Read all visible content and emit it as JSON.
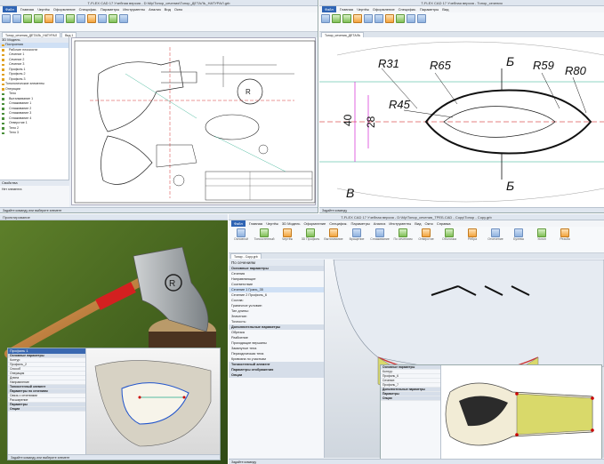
{
  "q1": {
    "title": "T-FLEX CAD 17 Учебная версия - D:\\My\\Топор_сечения\\Топор_ДЕТАЛЬ_НАТУРАЛ.grb",
    "menu": [
      "Файл",
      "Главная",
      "Чертёж",
      "Оформление",
      "Специфик.",
      "Параметры",
      "Инструменты",
      "Анализ",
      "Вид",
      "Окно"
    ],
    "tabs": [
      "Топор_сечения_ДЕТАЛЬ_НАТУРАЛ",
      "Вид 1"
    ],
    "tree_title": "3D Модель",
    "tree_rows": [
      "Построения",
      "Рабочие плоскости",
      "Сечение 1",
      "Сечение 2",
      "Сечение 3",
      "Профиль 1",
      "Профиль 2",
      "Профиль 3",
      "Топологические элементы",
      "Операции",
      "Тело",
      "Выталкивание 1",
      "Сглаживание 1",
      "Сглаживание 2",
      "Сглаживание 3",
      "Сглаживание 4",
      "Отверстие 1",
      "Тело 2",
      "Тело 3"
    ],
    "props_title": "Свойства",
    "props_label": "Нет элемента",
    "status": "Задайте команду или выберите элемент"
  },
  "q2": {
    "title": "T-FLEX CAD 17 Учебная версия - Топор_сечения",
    "menu": [
      "Файл",
      "Главная",
      "Чертёж",
      "Оформление",
      "Специфик.",
      "Параметры",
      "Вид"
    ],
    "tabs": [
      "Топор_сечения_ДЕТАЛЬ"
    ],
    "dims": [
      "R31",
      "R65",
      "R59",
      "R80",
      "R45",
      "40",
      "28",
      "Б",
      "Б",
      "В"
    ],
    "status": "Задайте команду"
  },
  "q3": {
    "window_label": "Проектирование",
    "panel_title": "Профиль 1",
    "panel_lines": [
      "Основные параметры",
      "Контур:",
      "Профиль_2",
      "Способ",
      "Операция",
      "Длина",
      "Направление",
      "Тонкостенный элемент",
      "Параметры по сечениям",
      "Связь с сечениями",
      "Расширение",
      "Параметры",
      "Опции"
    ],
    "status": "Задайте команду или выберите элемент"
  },
  "q4": {
    "title": "T-FLEX CAD 17 Учебная версия - D:\\My\\Топор_сечения_ТРЕБ.CAD - Copy\\Топор - Copy.grb",
    "menu": [
      "Файл",
      "Главная",
      "Чертёж",
      "3D Модель",
      "Оформление",
      "Специфик.",
      "Параметры",
      "Анализ",
      "Инструменты",
      "Вид",
      "Окно",
      "Справка"
    ],
    "ribbon_labels": [
      "Основной",
      "Тонкостенный",
      "Чертёж",
      "3D Профиль",
      "Вытягивание",
      "Вращение",
      "Сглаживание",
      "По сечениям",
      "Отверстие",
      "Оболочка",
      "Рёбра",
      "Отсечение",
      "Булева",
      "Уклон",
      "Резьба"
    ],
    "tab": "Топор - Copy.grb",
    "panel_title": "По сечениям",
    "panel_lines": [
      "Основные параметры",
      "Сечения",
      "Направляющие",
      "Соответствие",
      "Сечение 1 Грань_35",
      "Сечение 2 Профиль_6",
      "Состав:",
      "Граничное условие:",
      "Тип длины:",
      "Значение:",
      "Точность:",
      "Дополнительные параметры",
      "Обрезка",
      "Разбиение",
      "Проходящие вершины",
      "Замкнутые тела",
      "Периодическая тела",
      "Кривизна по участкам",
      "Тонкостенный элемент",
      "Параметры отображения",
      "Опции"
    ],
    "sub_lines": [
      "Основные параметры",
      "Контур:",
      "Профиль_6",
      "Сечение:",
      "Профиль_7",
      "Дополнительные параметры",
      "Параметры",
      "Опции"
    ],
    "status": "Задайте команду"
  }
}
